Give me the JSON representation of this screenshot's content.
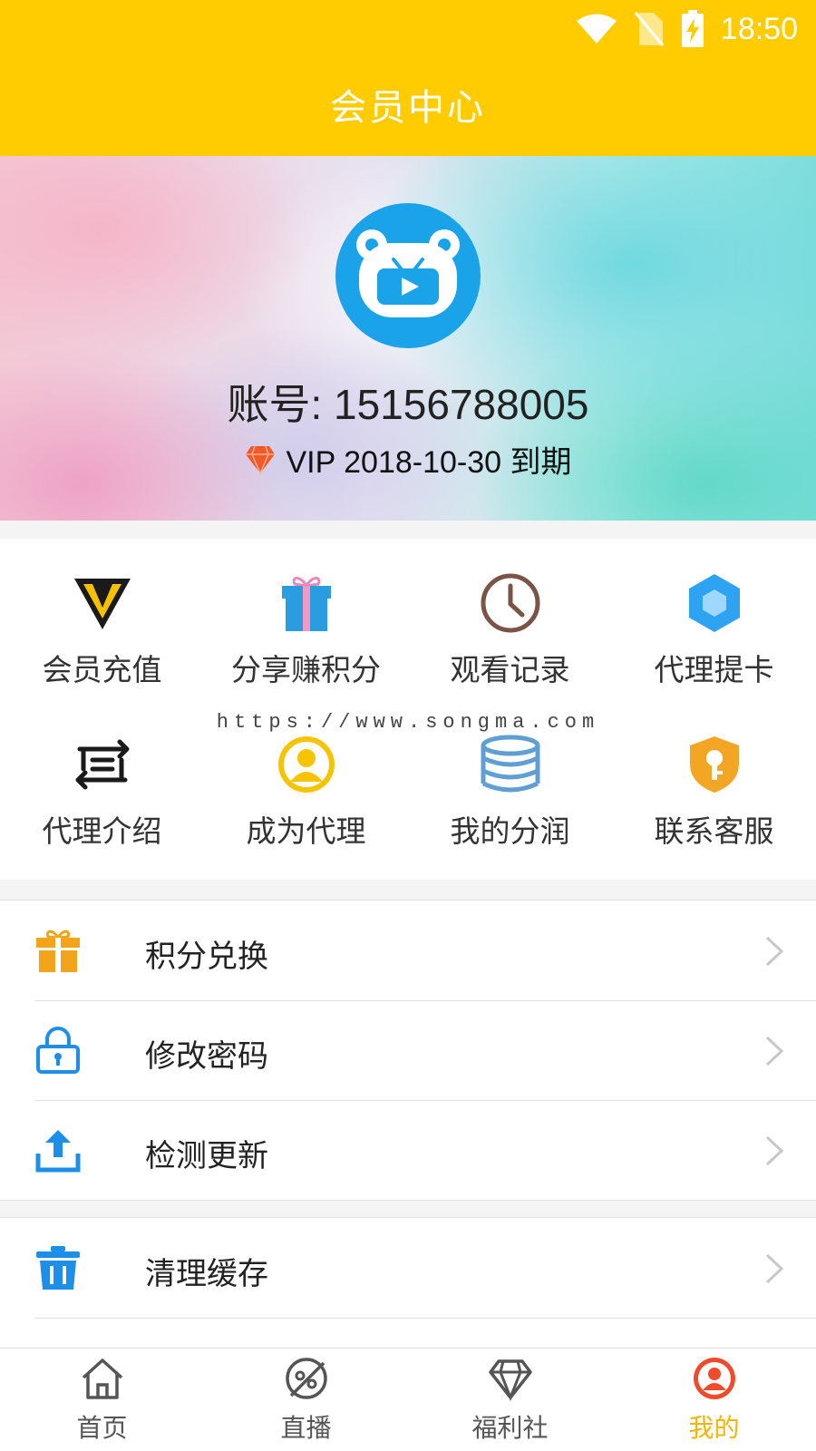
{
  "status_bar": {
    "time": "18:50",
    "icons": [
      "wifi-icon",
      "no-sim-icon",
      "battery-charging-icon"
    ]
  },
  "header": {
    "title": "会员中心"
  },
  "profile": {
    "account_label": "账号: 15156788005",
    "vip_text": "VIP 2018-10-30 到期",
    "avatar_icon": "bear-tv-logo-icon"
  },
  "grid": {
    "watermark": "https://www.songma.com",
    "items": [
      {
        "label": "会员充值",
        "icon": "vip-diamond-icon"
      },
      {
        "label": "分享赚积分",
        "icon": "gift-box-icon"
      },
      {
        "label": "观看记录",
        "icon": "clock-icon"
      },
      {
        "label": "代理提卡",
        "icon": "hexagon-icon"
      },
      {
        "label": "代理介绍",
        "icon": "transfer-icon"
      },
      {
        "label": "成为代理",
        "icon": "user-circle-icon"
      },
      {
        "label": "我的分润",
        "icon": "coins-stack-icon"
      },
      {
        "label": "联系客服",
        "icon": "shield-key-icon"
      }
    ]
  },
  "menu_group_1": [
    {
      "label": "积分兑换",
      "icon": "gift-icon"
    },
    {
      "label": "修改密码",
      "icon": "lock-icon"
    },
    {
      "label": "检测更新",
      "icon": "upload-icon"
    }
  ],
  "menu_group_2": [
    {
      "label": "清理缓存",
      "icon": "trash-icon"
    }
  ],
  "tabbar": [
    {
      "label": "首页",
      "icon": "home-icon",
      "active": false
    },
    {
      "label": "直播",
      "icon": "live-icon",
      "active": false
    },
    {
      "label": "福利社",
      "icon": "diamond-icon",
      "active": false
    },
    {
      "label": "我的",
      "icon": "user-icon",
      "active": true
    }
  ],
  "colors": {
    "header": "#fecc00",
    "accent_blue": "#2196f3",
    "tab_active": "#f7b500",
    "tab_active_icon": "#f04b2a"
  }
}
